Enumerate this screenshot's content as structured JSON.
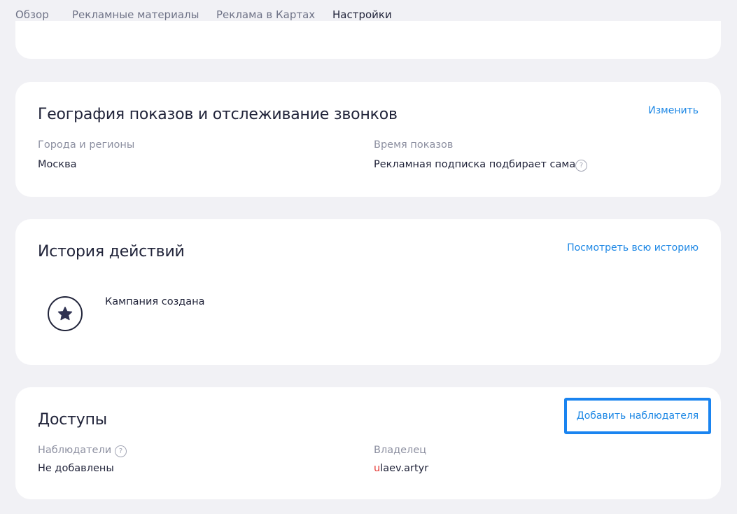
{
  "tabs": [
    {
      "label": "Обзор"
    },
    {
      "label": "Рекламные материалы"
    },
    {
      "label": "Реклама в Картах"
    },
    {
      "label": "Настройки"
    }
  ],
  "geo": {
    "title": "География показов и отслеживание звонков",
    "edit_link": "Изменить",
    "cities_label": "Города и регионы",
    "cities_value": "Москва",
    "time_label": "Время показов",
    "time_value": "Рекламная подписка подбирает сама",
    "help_glyph": "?"
  },
  "history": {
    "title": "История действий",
    "view_all_link": "Посмотреть всю историю",
    "events": [
      {
        "text": "Кампания создана",
        "icon": "star-icon"
      }
    ]
  },
  "access": {
    "title": "Доступы",
    "add_observer_button": "Добавить наблюдателя",
    "observers_label": "Наблюдатели",
    "observers_value": "Не добавлены",
    "owner_label": "Владелец",
    "owner_first_letter": "u",
    "owner_rest": "laev.artyr",
    "help_glyph": "?"
  },
  "colors": {
    "accent": "#1e88e5",
    "focus_border": "#1a84f0",
    "text": "#21243a",
    "muted": "#8d90a1",
    "background": "#f1f1f5",
    "owner_highlight": "#e53935"
  }
}
